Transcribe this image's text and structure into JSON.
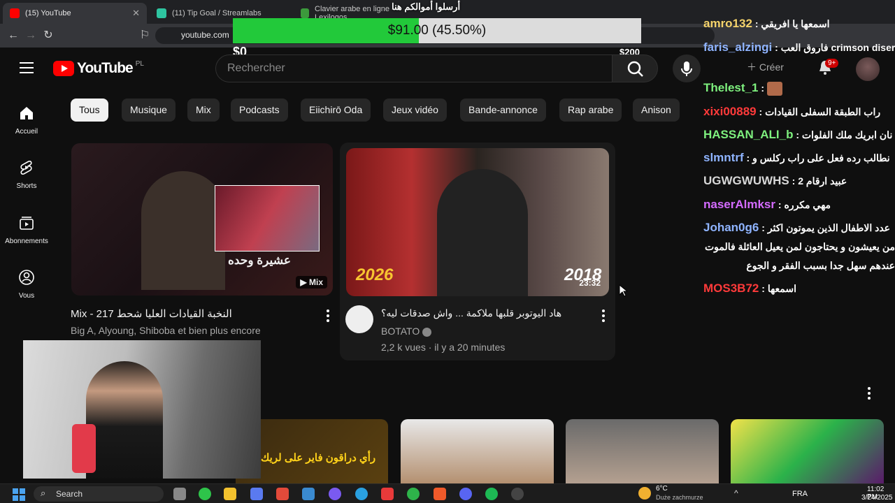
{
  "browser": {
    "tabs": [
      {
        "title": "(15) YouTube",
        "active": true
      },
      {
        "title": "(11) Tip Goal / Streamlabs",
        "active": false
      },
      {
        "title": "Clavier arabe en ligne - Lexilogos",
        "active": false
      }
    ],
    "url": "youtube.com"
  },
  "goal": {
    "title": "أرسلوا أموالكم هنا",
    "amount_text": "$91.00 (45.50%)",
    "progress_fraction": 0.455,
    "min_label": "$0",
    "max_label": "$200"
  },
  "youtube": {
    "logo_text": "YouTube",
    "region": "PL",
    "search_placeholder": "Rechercher",
    "create_label": "Créer",
    "notification_badge": "9+",
    "sidebar": [
      {
        "label": "Accueil",
        "icon": "home-icon"
      },
      {
        "label": "Shorts",
        "icon": "shorts-icon"
      },
      {
        "label": "Abonnements",
        "icon": "subscriptions-icon"
      },
      {
        "label": "Vous",
        "icon": "user-icon"
      }
    ],
    "chips": [
      "Tous",
      "Musique",
      "Mix",
      "Podcasts",
      "Eiichirō Oda",
      "Jeux vidéo",
      "Bande-annonce",
      "Rap arabe",
      "Anison"
    ],
    "videos": [
      {
        "title": "Mix - 217 النخبة القيادات العليا شحط",
        "meta": "Big A, Alyoung, Shiboba et bien plus encore",
        "badge": "Mix",
        "thumb_caption": "عشيرة وحده"
      },
      {
        "title": "هاد اليوتوبر قلبها ملاكمة ... واش صدقات ليه؟",
        "channel": "BOTATO",
        "meta": "2,2 k vues · il y a 20 minutes",
        "duration": "23:32",
        "thumb_left": "2026",
        "thumb_right": "2018"
      }
    ],
    "shorts_caption": "رأي دراقون فاير على لريك"
  },
  "chat": [
    {
      "user": "amro132",
      "color": "#f5d36b",
      "msg": "اسمعها يا افريقي"
    },
    {
      "user": "faris_alzingi",
      "color": "#8fb4ff",
      "msg": "فاروق العب crimson disert"
    },
    {
      "user": "Thelest_1",
      "color": "#7ef07e",
      "msg": ""
    },
    {
      "user": "xixi00889",
      "color": "#ff3a3a",
      "msg": "راب الطبقة السفلى القيادات"
    },
    {
      "user": "HASSAN_ALI_b",
      "color": "#7ef07e",
      "msg": "نان ابريك ملك الفلوات"
    },
    {
      "user": "slmntrf",
      "color": "#8fb4ff",
      "msg": "نطالب رده فعل على راب ركلس و"
    },
    {
      "user": "UGWGWUWHS",
      "color": "#d8d8d8",
      "msg": "عبيد ارقام 2"
    },
    {
      "user": "naserAlmksr",
      "color": "#d46bff",
      "msg": "مهي مكرره"
    },
    {
      "user": "Johan0g6",
      "color": "#8fb4ff",
      "msg": "عدد الاطفال الذين يموتون اكثر"
    },
    {
      "user": "",
      "color": "#fff",
      "msg": "من يعيشون و يحتاجون لمن يعيل العائلة فالموت"
    },
    {
      "user": "",
      "color": "#fff",
      "msg": "عندهم سهل جدا بسبب الفقر و الجوع"
    },
    {
      "user": "MOS3B72",
      "color": "#ff3a3a",
      "msg": "اسمعها"
    }
  ],
  "taskbar": {
    "search_label": "Search",
    "weather_temp": "6°C",
    "weather_desc": "Duże zachmurze",
    "lang": "FRA",
    "time": "11:02 PM",
    "date": "3/24/2025"
  },
  "colors": {
    "goal_fill": "#22c93a",
    "yt_red": "#ff0000",
    "bg": "#0f0f0f"
  }
}
